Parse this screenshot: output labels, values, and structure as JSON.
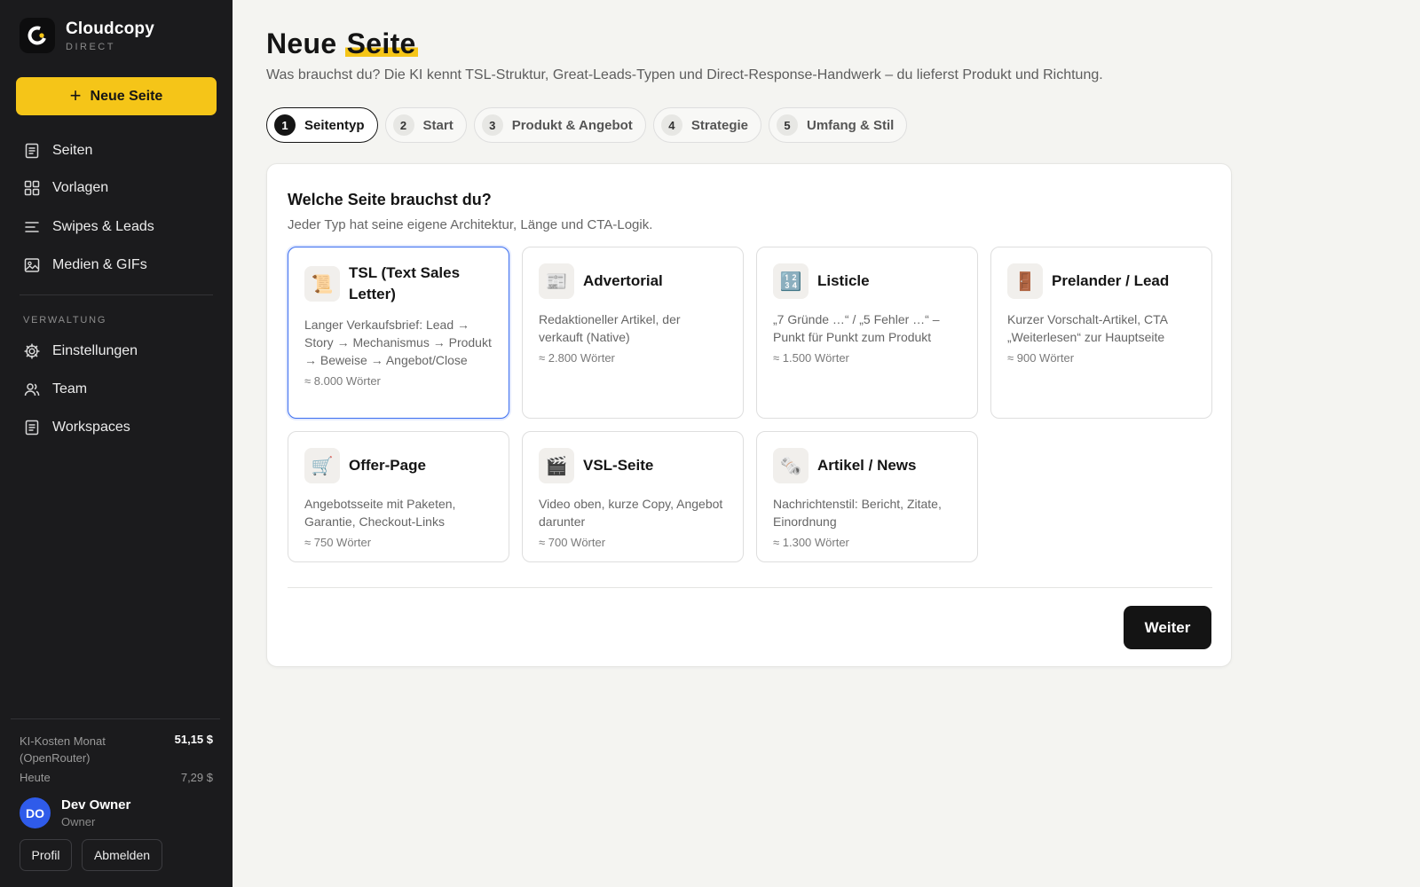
{
  "brand": {
    "title": "Cloudcopy",
    "subtitle": "DIRECT"
  },
  "sidebar": {
    "new_page_label": "Neue Seite",
    "items": [
      {
        "label": "Seiten",
        "icon": "document-icon"
      },
      {
        "label": "Vorlagen",
        "icon": "grid-icon"
      },
      {
        "label": "Swipes & Leads",
        "icon": "lines-icon"
      },
      {
        "label": "Medien & GIFs",
        "icon": "image-icon"
      }
    ],
    "section_label": "VERWALTUNG",
    "admin_items": [
      {
        "label": "Einstellungen",
        "icon": "gear-icon"
      },
      {
        "label": "Team",
        "icon": "users-icon"
      },
      {
        "label": "Workspaces",
        "icon": "document-icon"
      }
    ],
    "cost": {
      "label": "KI-Kosten Monat (OpenRouter)",
      "value": "51,15 $",
      "today_label": "Heute",
      "today_value": "7,29 $"
    },
    "user": {
      "initials": "DO",
      "name": "Dev Owner",
      "role": "Owner"
    },
    "profile_label": "Profil",
    "logout_label": "Abmelden"
  },
  "main": {
    "title_part1": "Neue",
    "title_part2": "Seite",
    "subtitle": "Was brauchst du? Die KI kennt TSL-Struktur, Great-Leads-Typen und Direct-Response-Handwerk – du lieferst Produkt und Richtung.",
    "steps": [
      {
        "num": "1",
        "label": "Seitentyp",
        "active": true
      },
      {
        "num": "2",
        "label": "Start"
      },
      {
        "num": "3",
        "label": "Produkt & Angebot"
      },
      {
        "num": "4",
        "label": "Strategie"
      },
      {
        "num": "5",
        "label": "Umfang & Stil"
      }
    ],
    "card": {
      "title": "Welche Seite brauchst du?",
      "subtitle": "Jeder Typ hat seine eigene Architektur, Länge und CTA-Logik.",
      "types": [
        {
          "icon": "📜",
          "name": "TSL (Text Sales Letter)",
          "desc": "Langer Verkaufsbrief: Lead → Story → Mechanismus → Produkt → Beweise → Angebot/Close",
          "words": "≈ 8.000 Wörter",
          "selected": true
        },
        {
          "icon": "📰",
          "name": "Advertorial",
          "desc": "Redaktioneller Artikel, der verkauft (Native)",
          "words": "≈ 2.800 Wörter"
        },
        {
          "icon": "🔢",
          "name": "Listicle",
          "desc": "„7 Gründe …“ / „5 Fehler …“ – Punkt für Punkt zum Produkt",
          "words": "≈ 1.500 Wörter"
        },
        {
          "icon": "🚪",
          "name": "Prelander / Lead",
          "desc": "Kurzer Vorschalt-Artikel, CTA „Weiterlesen“ zur Hauptseite",
          "words": "≈ 900 Wörter"
        },
        {
          "icon": "🛒",
          "name": "Offer-Page",
          "desc": "Angebotsseite mit Paketen, Garantie, Checkout-Links",
          "words": "≈ 750 Wörter"
        },
        {
          "icon": "🎬",
          "name": "VSL-Seite",
          "desc": "Video oben, kurze Copy, Angebot darunter",
          "words": "≈ 700 Wörter"
        },
        {
          "icon": "🗞️",
          "name": "Artikel / News",
          "desc": "Nachrichtenstil: Bericht, Zitate, Einordnung",
          "words": "≈ 1.300 Wörter"
        }
      ],
      "next_label": "Weiter"
    }
  }
}
